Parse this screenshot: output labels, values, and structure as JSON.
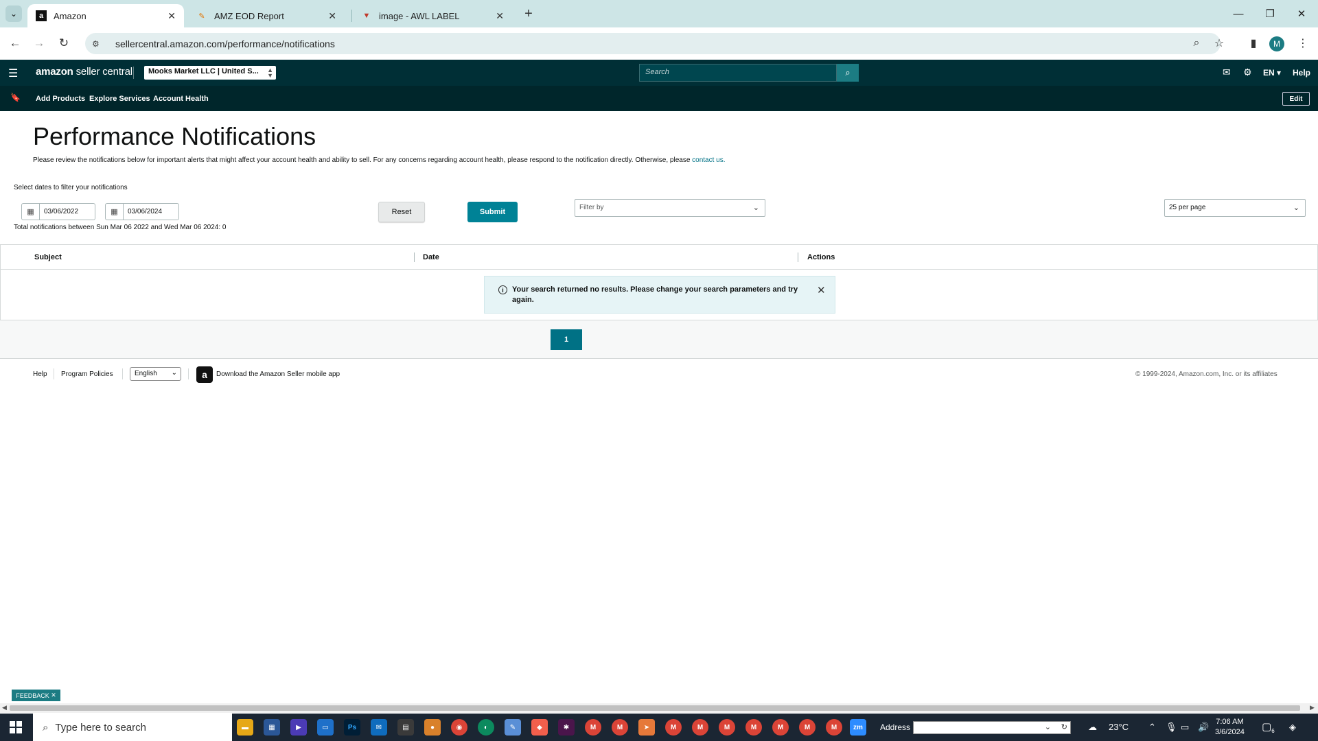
{
  "browser": {
    "tabs": [
      {
        "title": "Amazon",
        "active": true
      },
      {
        "title": "AMZ EOD Report",
        "active": false
      },
      {
        "title": "image - AWL LABEL",
        "active": false
      }
    ],
    "url": "sellercentral.amazon.com/performance/notifications",
    "profile_initial": "M"
  },
  "header": {
    "logo_bold": "amazon",
    "logo_light": " seller central",
    "account": "Mooks Market LLC | United S...",
    "search_placeholder": "Search",
    "language": "EN",
    "help": "Help"
  },
  "subnav": {
    "links": [
      "Add Products",
      "Explore Services",
      "Account Health"
    ],
    "edit": "Edit"
  },
  "page": {
    "title": "Performance Notifications",
    "intro": "Please review the notifications below for important alerts that might affect your account health and ability to sell. For any concerns regarding account health, please respond to the notification directly. Otherwise, please ",
    "intro_link": "contact us.",
    "date_label": "Select dates to filter your notifications",
    "date_from": "03/06/2022",
    "date_to": "03/06/2024",
    "total_text": "Total notifications between Sun Mar 06 2022 and Wed Mar 06 2024: 0",
    "reset": "Reset",
    "submit": "Submit",
    "filter_placeholder": "Filter by",
    "per_page": "25 per page"
  },
  "table": {
    "columns": [
      "Subject",
      "Date",
      "Actions"
    ],
    "alert": "Your search returned no results. Please change your search parameters and try again."
  },
  "pagination": {
    "current": "1"
  },
  "footer": {
    "help": "Help",
    "policies": "Program Policies",
    "language": "English",
    "app_text": "Download the Amazon Seller mobile app",
    "copyright": "© 1999-2024, Amazon.com, Inc. or its affiliates"
  },
  "feedback": "FEEDBACK",
  "taskbar": {
    "search_placeholder": "Type here to search",
    "address_label": "Address",
    "weather": "23°C",
    "time": "7:06 AM",
    "date": "3/6/2024",
    "notifications": "6"
  },
  "colors": {
    "header_bg": "#002f36",
    "subnav_bg": "#00262b",
    "accent": "#008296",
    "link": "#007185"
  }
}
